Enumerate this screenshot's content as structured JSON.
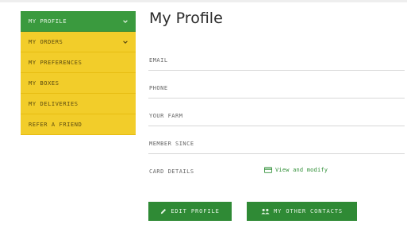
{
  "sidebar": {
    "items": [
      {
        "label": "MY PROFILE",
        "active": true,
        "chevron": true
      },
      {
        "label": "MY ORDERS",
        "active": false,
        "chevron": true
      },
      {
        "label": "MY PREFERENCES",
        "active": false,
        "chevron": false
      },
      {
        "label": "MY BOXES",
        "active": false,
        "chevron": false
      },
      {
        "label": "MY DELIVERIES",
        "active": false,
        "chevron": false
      },
      {
        "label": "REFER A FRIEND",
        "active": false,
        "chevron": false
      }
    ]
  },
  "main": {
    "title": "My Profile",
    "fields": [
      {
        "label": "EMAIL",
        "value": ""
      },
      {
        "label": "PHONE",
        "value": ""
      },
      {
        "label": "YOUR FARM",
        "value": ""
      },
      {
        "label": "MEMBER SINCE",
        "value": ""
      }
    ],
    "card": {
      "label": "CARD DETAILS",
      "link_text": "View and modify",
      "icon": "credit-card-icon"
    },
    "buttons": {
      "edit_profile": "EDIT PROFILE",
      "other_contacts": "MY OTHER CONTACTS"
    }
  },
  "colors": {
    "sidebar_active": "#3a9a3e",
    "sidebar_item": "#f2cd2a",
    "button": "#2f8a35",
    "link": "#2f8f36"
  }
}
